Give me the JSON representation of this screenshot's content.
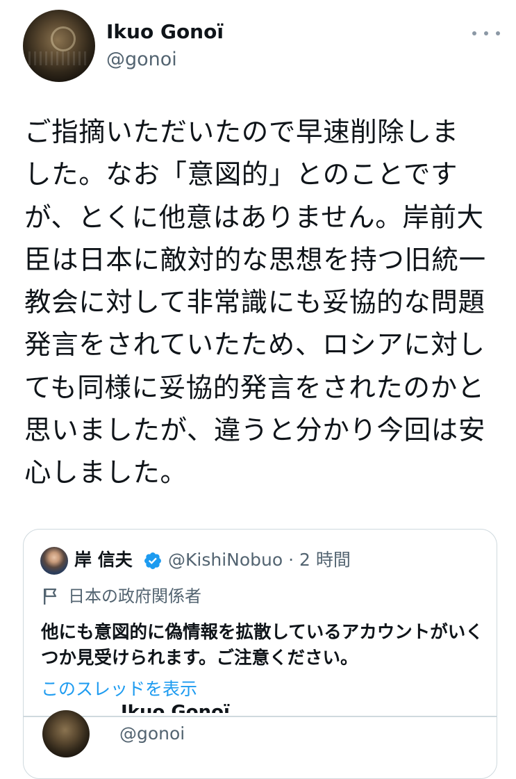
{
  "tweet": {
    "author": {
      "display_name": "Ikuo Gonoï",
      "handle": "@gonoi"
    },
    "text": "ご指摘いただいたので早速削除しま\nした。なお「意図的」とのことですが、とくに他意はありません。岸前大臣は日本に敵対的な思想を持つ旧統一教会に対して非常識にも妥協的な問題発言をされていたため、ロシアに対しても同様に妥協的発言をされたのかと思いましたが、違うと分かり今回は安心しました。",
    "more_icon": "more-horizontal-icon"
  },
  "quoted_tweet": {
    "author": {
      "display_name": "岸 信夫",
      "verified_icon": "verified-badge-icon",
      "handle_time": "@KishiNobuo · 2 時間"
    },
    "label_icon": "flag-icon",
    "label": "日本の政府関係者",
    "text": "他にも意図的に偽情報を拡散しているアカウントがいくつか見受けられます。ご注意ください。",
    "show_thread": "このスレッドを表示",
    "nested": {
      "display_name": "Ikuo Gonoï",
      "handle": "@gonoi"
    }
  },
  "colors": {
    "text": "#0f1419",
    "secondary": "#536471",
    "accent": "#1d9bf0",
    "border": "#cfd9de"
  }
}
